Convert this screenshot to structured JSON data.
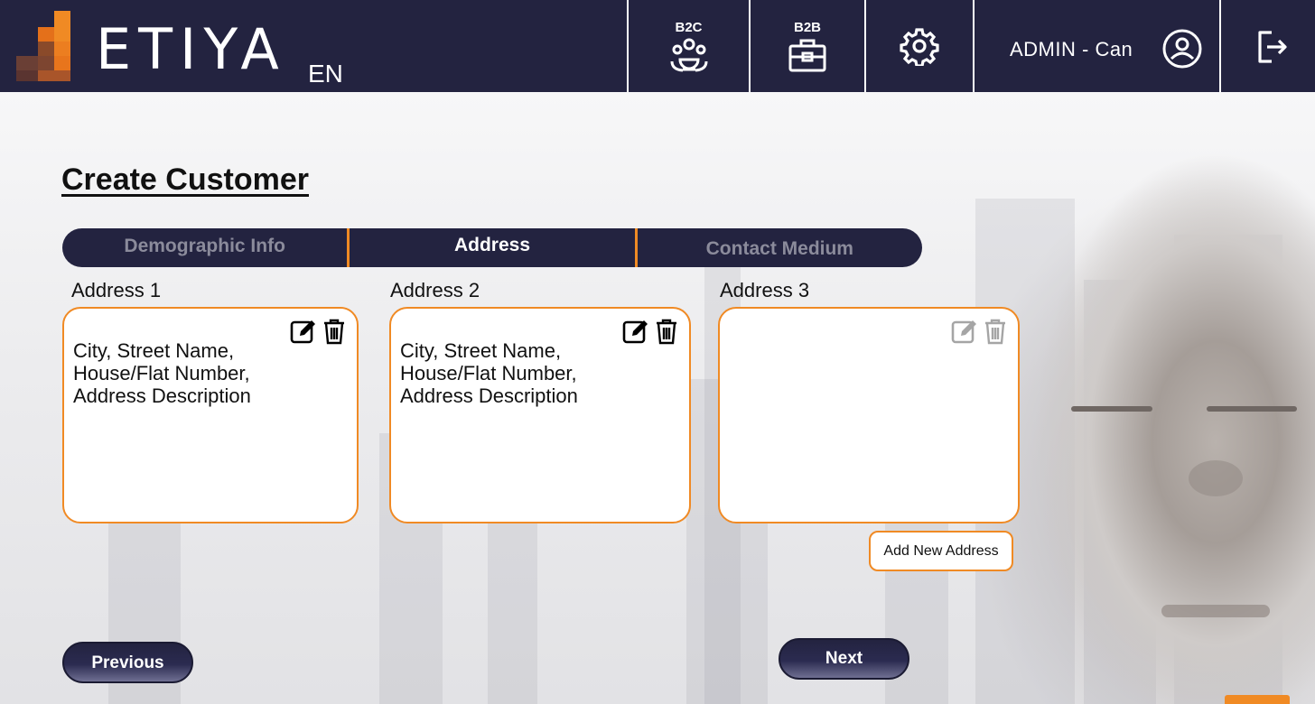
{
  "brand": {
    "name": "ETIYA",
    "language": "EN",
    "accent_color": "#f08a24",
    "header_color": "#232340"
  },
  "header": {
    "b2c_label": "B2C",
    "b2b_label": "B2B",
    "user_label": "ADMIN - Can"
  },
  "page": {
    "title": "Create Customer"
  },
  "tabs": [
    {
      "label": "Demographic Info",
      "active": false
    },
    {
      "label": "Address",
      "active": true
    },
    {
      "label": "Contact Medium",
      "active": false
    }
  ],
  "addresses": [
    {
      "label": "Address 1",
      "text": " City, Street Name,\nHouse/Flat Number,\nAddress Description",
      "actions_enabled": true
    },
    {
      "label": "Address 2",
      "text": " City, Street Name,\nHouse/Flat Number,\nAddress Description",
      "actions_enabled": true
    },
    {
      "label": "Address 3",
      "text": "",
      "actions_enabled": false
    }
  ],
  "actions": {
    "add_address": "Add New Address",
    "previous": "Previous",
    "next": "Next"
  }
}
